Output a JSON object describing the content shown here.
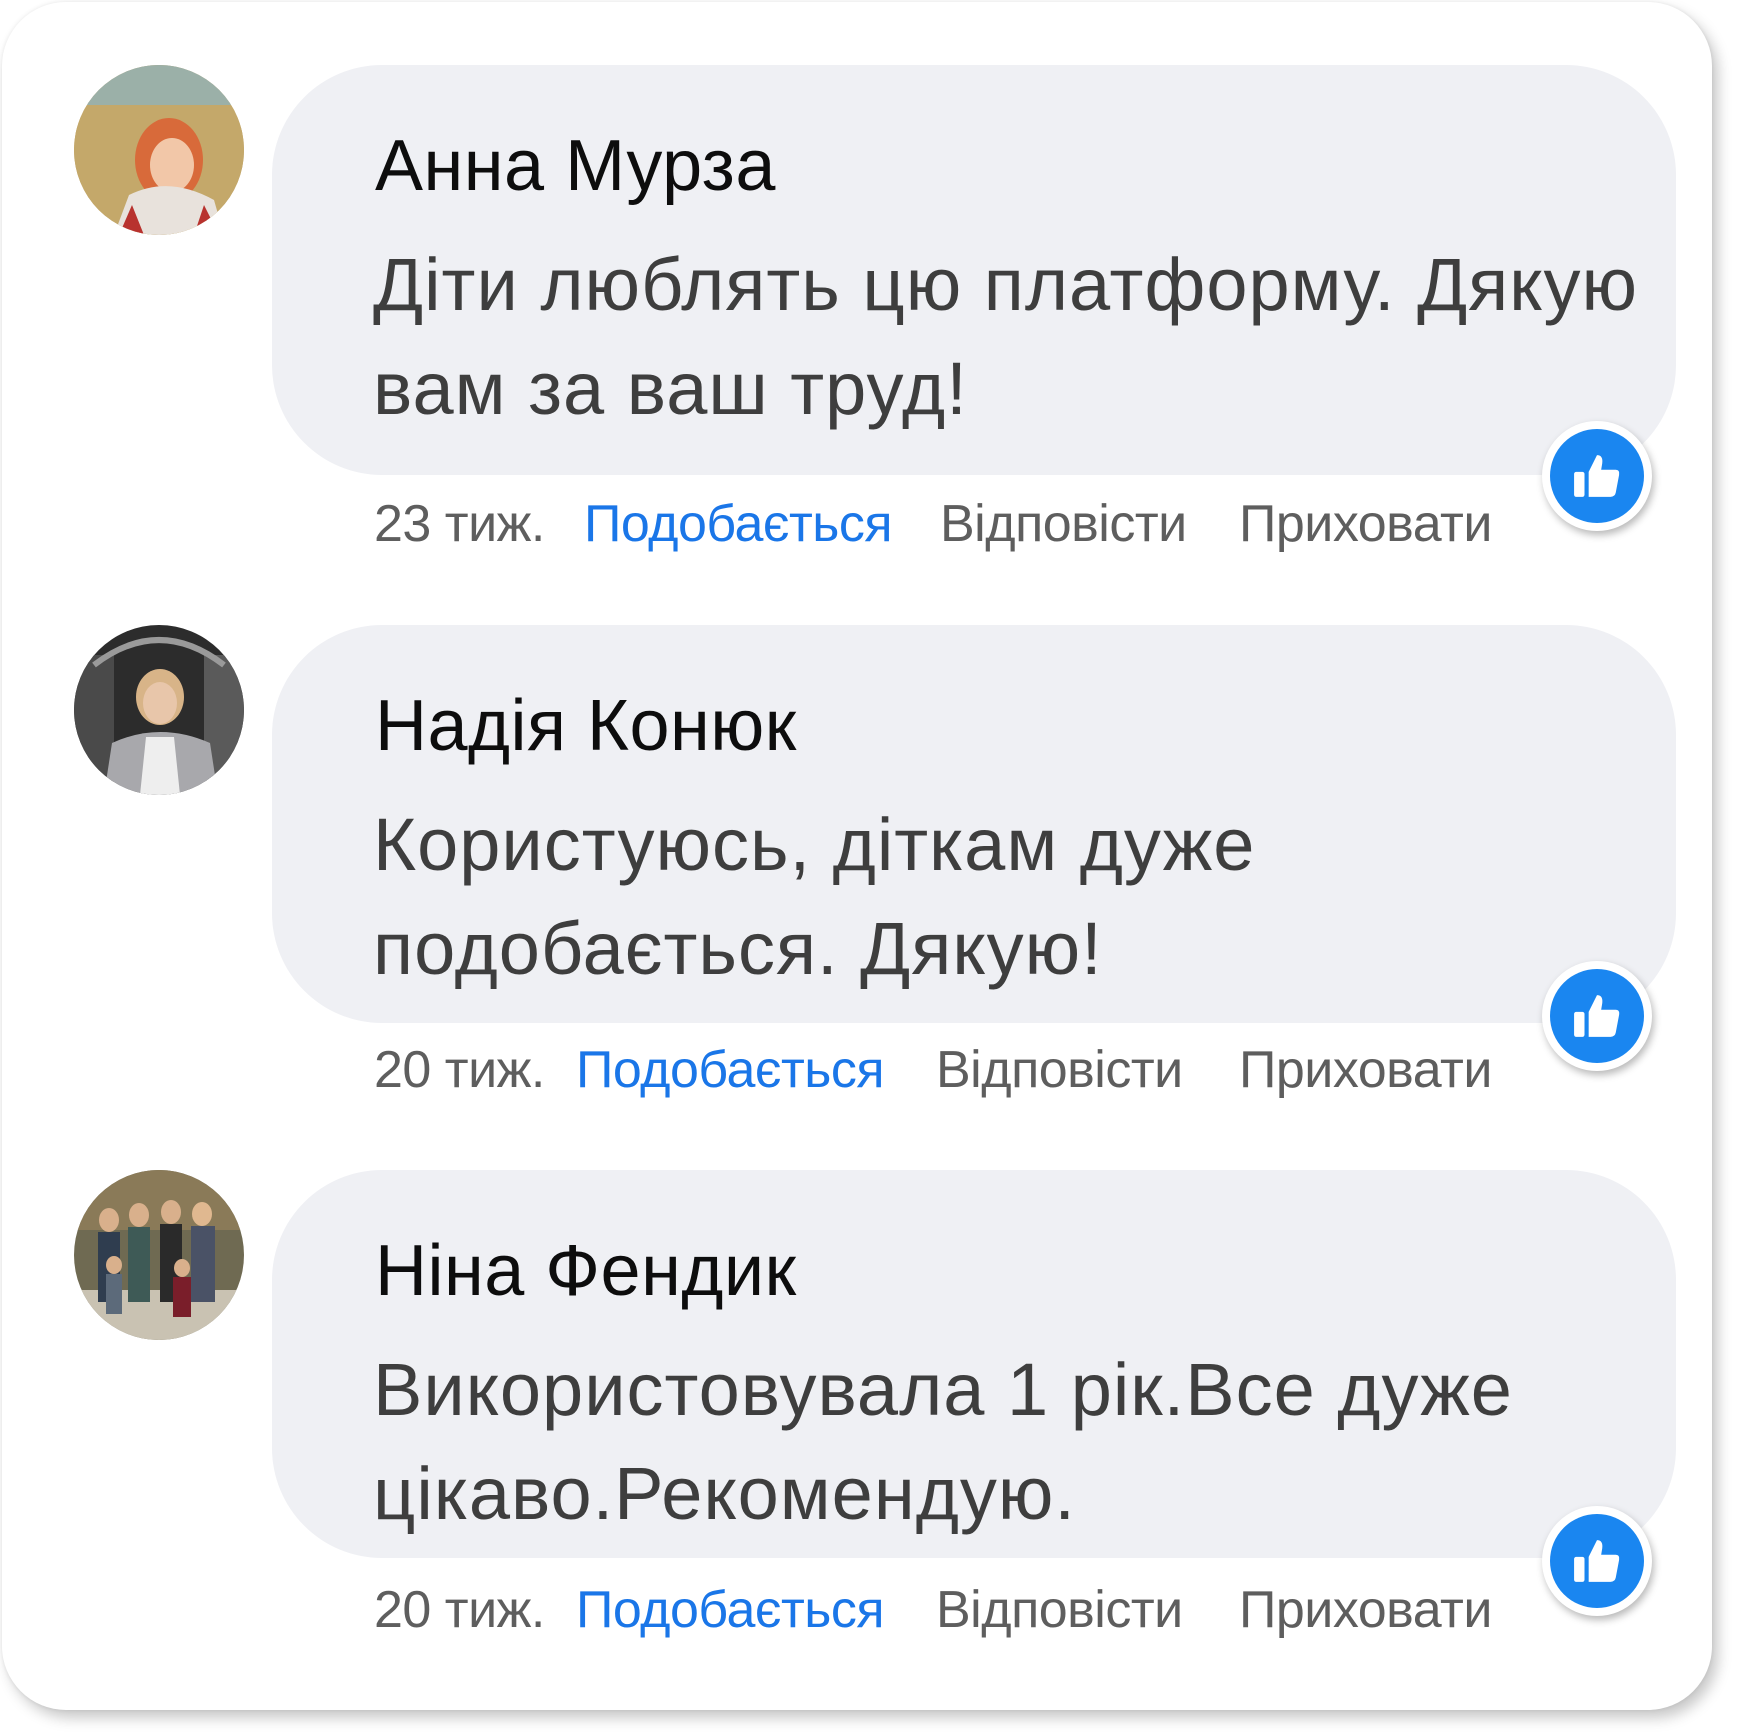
{
  "comments": [
    {
      "author": "Анна Мурза",
      "text": "Діти люблять цю платформу. Дякую вам за ваш труд!",
      "time": "23 тиж.",
      "like_label": "Подобається",
      "reply_label": "Відповісти",
      "hide_label": "Приховати"
    },
    {
      "author": "Надія Конюк",
      "text": "Користуюсь, діткам дуже подобається. Дякую!",
      "time": "20 тиж.",
      "like_label": "Подобається",
      "reply_label": "Відповісти",
      "hide_label": "Приховати"
    },
    {
      "author": "Ніна Фендик",
      "text": "Використовувала 1 рік.Все дуже цікаво.Рекомендую.",
      "time": "20 тиж.",
      "like_label": "Подобається",
      "reply_label": "Відповісти",
      "hide_label": "Приховати"
    }
  ],
  "icons": {
    "avatar": "avatar-photo",
    "reaction": "thumbs-up-icon"
  },
  "colors": {
    "bubble": "#eff0f4",
    "like_link": "#1a76e8",
    "reaction_badge": "#1a86f0",
    "meta_text": "#5e5e5e"
  }
}
